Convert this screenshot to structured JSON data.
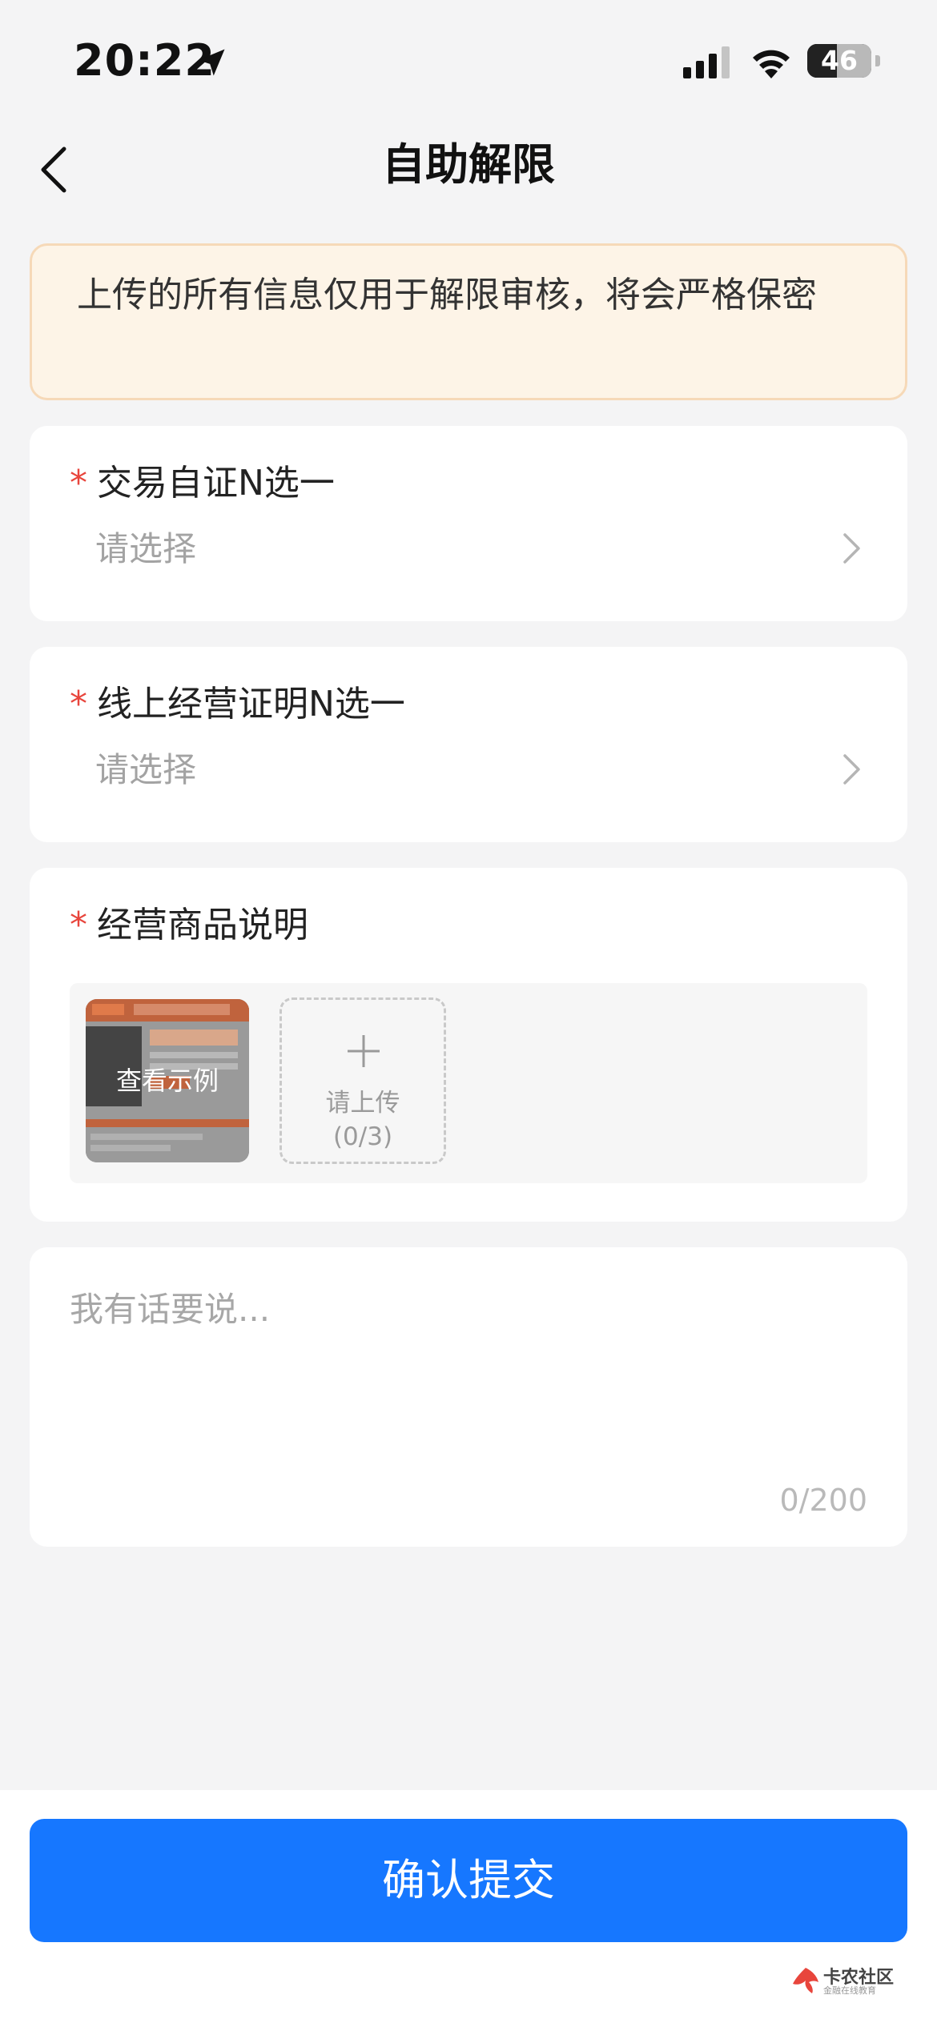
{
  "status_bar": {
    "time": "20:22",
    "battery": "46",
    "battery_level": 0.46
  },
  "nav": {
    "title": "自助解限"
  },
  "notice": {
    "text": "上传的所有信息仅用于解限审核，将会严格保密"
  },
  "fields": {
    "trade_proof": {
      "label": "交易自证N选一",
      "placeholder": "请选择"
    },
    "online_proof": {
      "label": "线上经营证明N选一",
      "placeholder": "请选择"
    },
    "goods_desc": {
      "label": "经营商品说明",
      "example_label": "查看示例",
      "upload_label": "请上传",
      "upload_count": "(0/3)"
    },
    "remark": {
      "placeholder": "我有话要说...",
      "count": "0/200"
    }
  },
  "required_mark": "*",
  "submit": {
    "label": "确认提交"
  },
  "watermark": {
    "title": "卡农社区",
    "subtitle": "金融在线教育"
  },
  "colors": {
    "primary": "#1677ff",
    "required": "#e8453c",
    "notice_bg": "#fdf4e7",
    "notice_border": "#f6d9b8",
    "page_bg": "#f4f4f5"
  }
}
